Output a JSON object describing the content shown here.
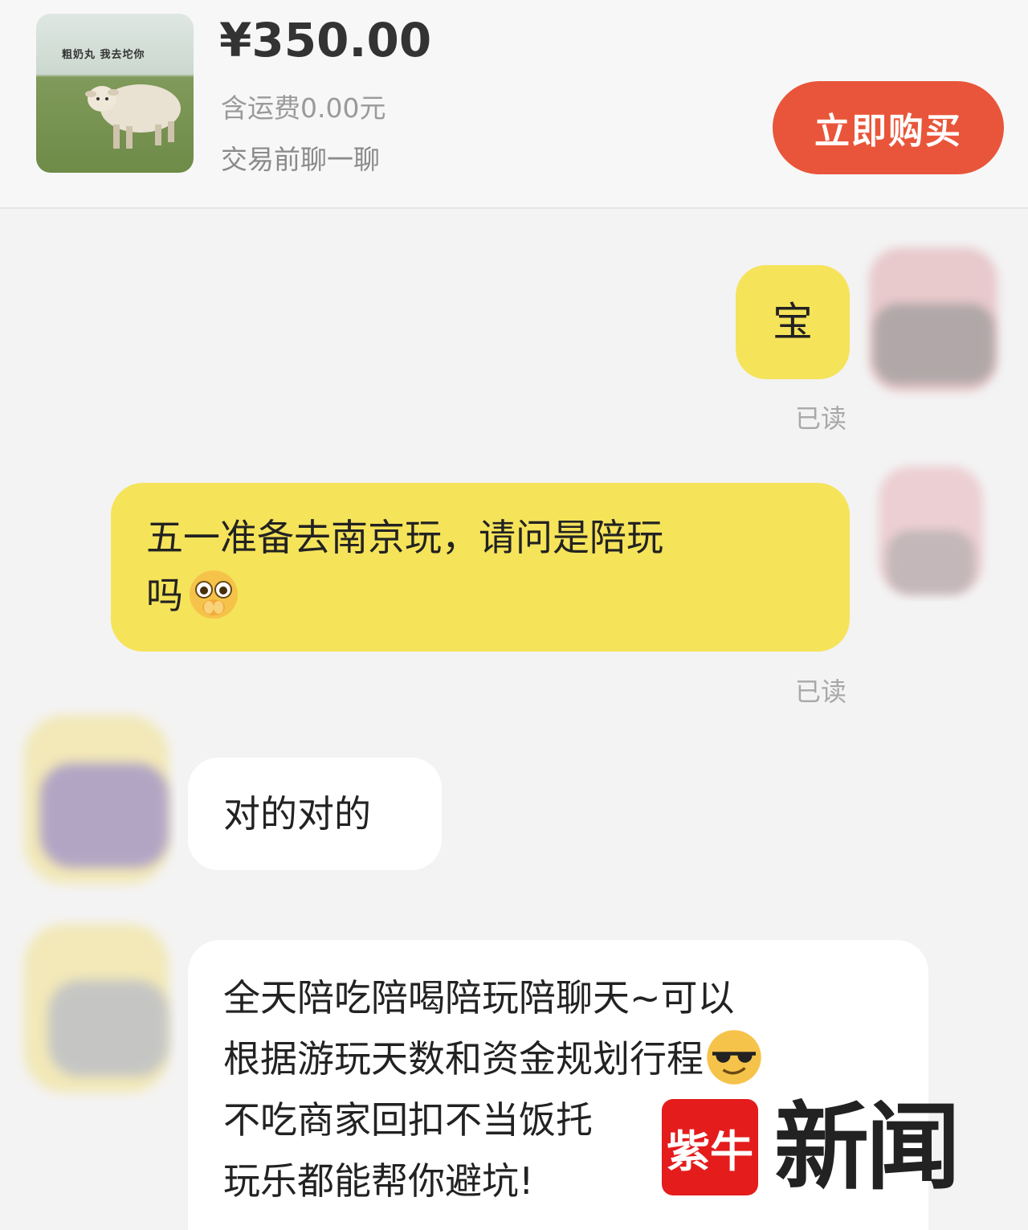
{
  "product": {
    "thumbnail_caption": "粗奶丸  我去坨你",
    "price": "¥350.00",
    "shipping": "含运费0.00元",
    "chat_hint": "交易前聊一聊",
    "buy_label": "立即购买"
  },
  "messages": [
    {
      "side": "right",
      "text": "宝",
      "status": "已读"
    },
    {
      "side": "right",
      "text_line1": "五一准备去南京玩，请问是陪玩",
      "text_line2": "吗",
      "status": "已读"
    },
    {
      "side": "left",
      "text": "对的对的"
    },
    {
      "side": "left",
      "lines": [
        "全天陪吃陪喝陪玩陪聊天~可以",
        "根据游玩天数和资金规划行程",
        "不吃商家回扣不当饭托",
        "玩乐都能帮你避坑!"
      ]
    }
  ],
  "watermark": {
    "logo_text": "紫牛",
    "brand_text": "新闻"
  },
  "colors": {
    "buy_button": "#e9553a",
    "outgoing_bubble": "#f5e35a",
    "incoming_bubble": "#ffffff"
  }
}
